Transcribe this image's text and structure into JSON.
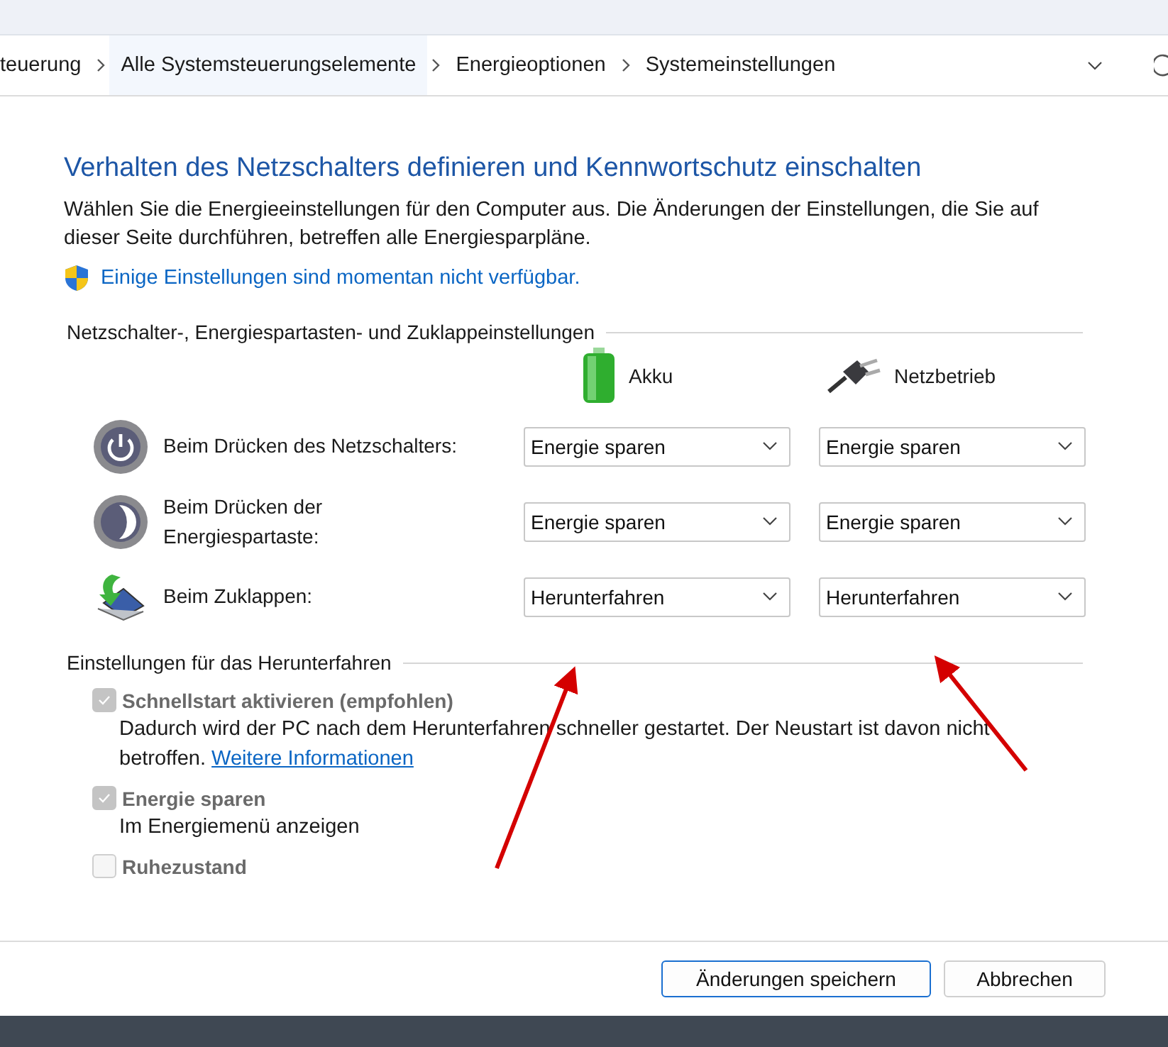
{
  "breadcrumb": {
    "items": [
      {
        "label": "teuerung",
        "selected": false
      },
      {
        "label": "Alle Systemsteuerungselemente",
        "selected": true
      },
      {
        "label": "Energieoptionen",
        "selected": false
      },
      {
        "label": "Systemeinstellungen",
        "selected": false
      }
    ]
  },
  "title": "Verhalten des Netzschalters definieren und Kennwortschutz einschalten",
  "description": "Wählen Sie die Energieeinstellungen für den Computer aus. Die Änderungen der Einstellungen, die Sie auf dieser Seite durchführen, betreffen alle Energiesparpläne.",
  "notice": {
    "text": "Einige Einstellungen sind momentan nicht verfügbar."
  },
  "power_section": {
    "heading": "Netzschalter-, Energiespartasten- und Zuklappeinstellungen",
    "columns": [
      {
        "kind": "battery",
        "label": "Akku"
      },
      {
        "kind": "plug",
        "label": "Netzbetrieb"
      }
    ],
    "rows": [
      {
        "kind": "power",
        "label": "Beim Drücken des Netzschalters:",
        "values": [
          "Energie sparen",
          "Energie sparen"
        ]
      },
      {
        "kind": "sleep",
        "label": "Beim Drücken der Energiespartaste:",
        "values": [
          "Energie sparen",
          "Energie sparen"
        ]
      },
      {
        "kind": "lid",
        "label": "Beim Zuklappen:",
        "values": [
          "Herunterfahren",
          "Herunterfahren"
        ]
      }
    ]
  },
  "shutdown_section": {
    "heading": "Einstellungen für das Herunterfahren",
    "options": [
      {
        "label": "Schnellstart aktivieren (empfohlen)",
        "checked": true,
        "disabled": true,
        "description": "Dadurch wird der PC nach dem Herunterfahren schneller gestartet. Der Neustart ist davon nicht betroffen.",
        "link": "Weitere Informationen"
      },
      {
        "label": "Energie sparen",
        "checked": true,
        "disabled": true,
        "description": "Im Energiemenü anzeigen"
      },
      {
        "label": "Ruhezustand",
        "checked": false,
        "disabled": true
      }
    ]
  },
  "buttons": [
    {
      "label": "Änderungen speichern",
      "primary": true
    },
    {
      "label": "Abbrechen",
      "primary": false
    }
  ]
}
